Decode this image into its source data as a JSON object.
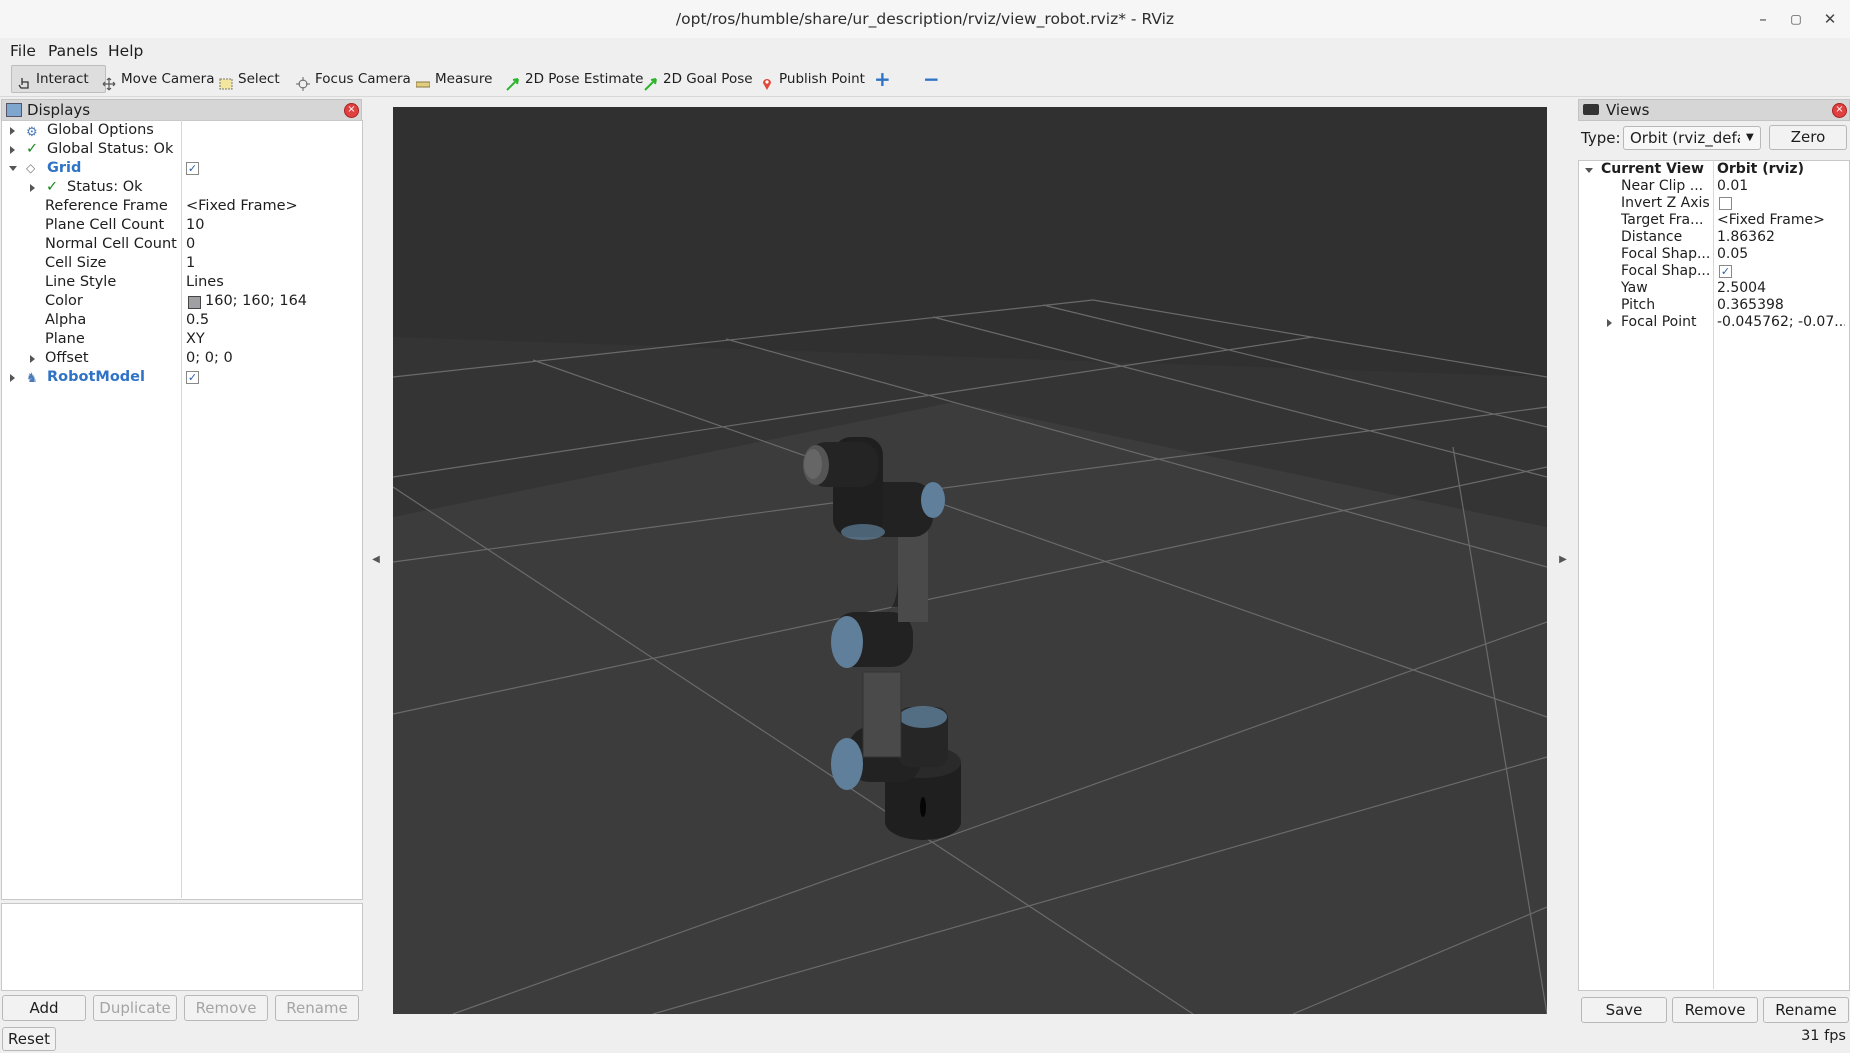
{
  "window": {
    "title": "/opt/ros/humble/share/ur_description/rviz/view_robot.rviz* - RViz",
    "minimize": "–",
    "maximize": "▢",
    "close": "✕"
  },
  "menu": {
    "file": "File",
    "panels": "Panels",
    "help": "Help"
  },
  "toolbar": {
    "interact": "Interact",
    "move_camera": "Move Camera",
    "select": "Select",
    "focus_camera": "Focus Camera",
    "measure": "Measure",
    "pose_estimate": "2D Pose Estimate",
    "goal_pose": "2D Goal Pose",
    "publish_point": "Publish Point",
    "add_tool": "+",
    "remove_tool": "−"
  },
  "displays": {
    "title": "Displays",
    "items": [
      {
        "label": "Global Options",
        "value": ""
      },
      {
        "label": "Global Status: Ok",
        "value": ""
      },
      {
        "label": "Grid",
        "value": "✓"
      },
      {
        "label": "Status: Ok",
        "value": ""
      },
      {
        "label": "Reference Frame",
        "value": "<Fixed Frame>"
      },
      {
        "label": "Plane Cell Count",
        "value": "10"
      },
      {
        "label": "Normal Cell Count",
        "value": "0"
      },
      {
        "label": "Cell Size",
        "value": "1"
      },
      {
        "label": "Line Style",
        "value": "Lines"
      },
      {
        "label": "Color",
        "value": "160; 160; 164"
      },
      {
        "label": "Alpha",
        "value": "0.5"
      },
      {
        "label": "Plane",
        "value": "XY"
      },
      {
        "label": "Offset",
        "value": "0; 0; 0"
      },
      {
        "label": "RobotModel",
        "value": "✓"
      }
    ],
    "grid_color": "#a0a0a4",
    "buttons": {
      "add": "Add",
      "duplicate": "Duplicate",
      "remove": "Remove",
      "rename": "Rename"
    }
  },
  "views": {
    "title": "Views",
    "type_label": "Type:",
    "type_value": "Orbit (rviz_defau",
    "zero": "Zero",
    "items": [
      {
        "label": "Current View",
        "value": "Orbit (rviz)"
      },
      {
        "label": "Near Clip ...",
        "value": "0.01"
      },
      {
        "label": "Invert Z Axis",
        "value": ""
      },
      {
        "label": "Target Fra...",
        "value": "<Fixed Frame>"
      },
      {
        "label": "Distance",
        "value": "1.86362"
      },
      {
        "label": "Focal Shap...",
        "value": "0.05"
      },
      {
        "label": "Focal Shap...",
        "value": "✓"
      },
      {
        "label": "Yaw",
        "value": "2.5004"
      },
      {
        "label": "Pitch",
        "value": "0.365398"
      },
      {
        "label": "Focal Point",
        "value": "-0.045762; -0.07..."
      }
    ],
    "buttons": {
      "save": "Save",
      "remove": "Remove",
      "rename": "Rename"
    }
  },
  "status": {
    "reset": "Reset",
    "fps": "31 fps"
  },
  "colors": {
    "viewport_bg": "#303030",
    "accent_blue": "#2f73c7",
    "status_green": "#1a8a1a",
    "robot_cap": "#5f7f9a"
  }
}
